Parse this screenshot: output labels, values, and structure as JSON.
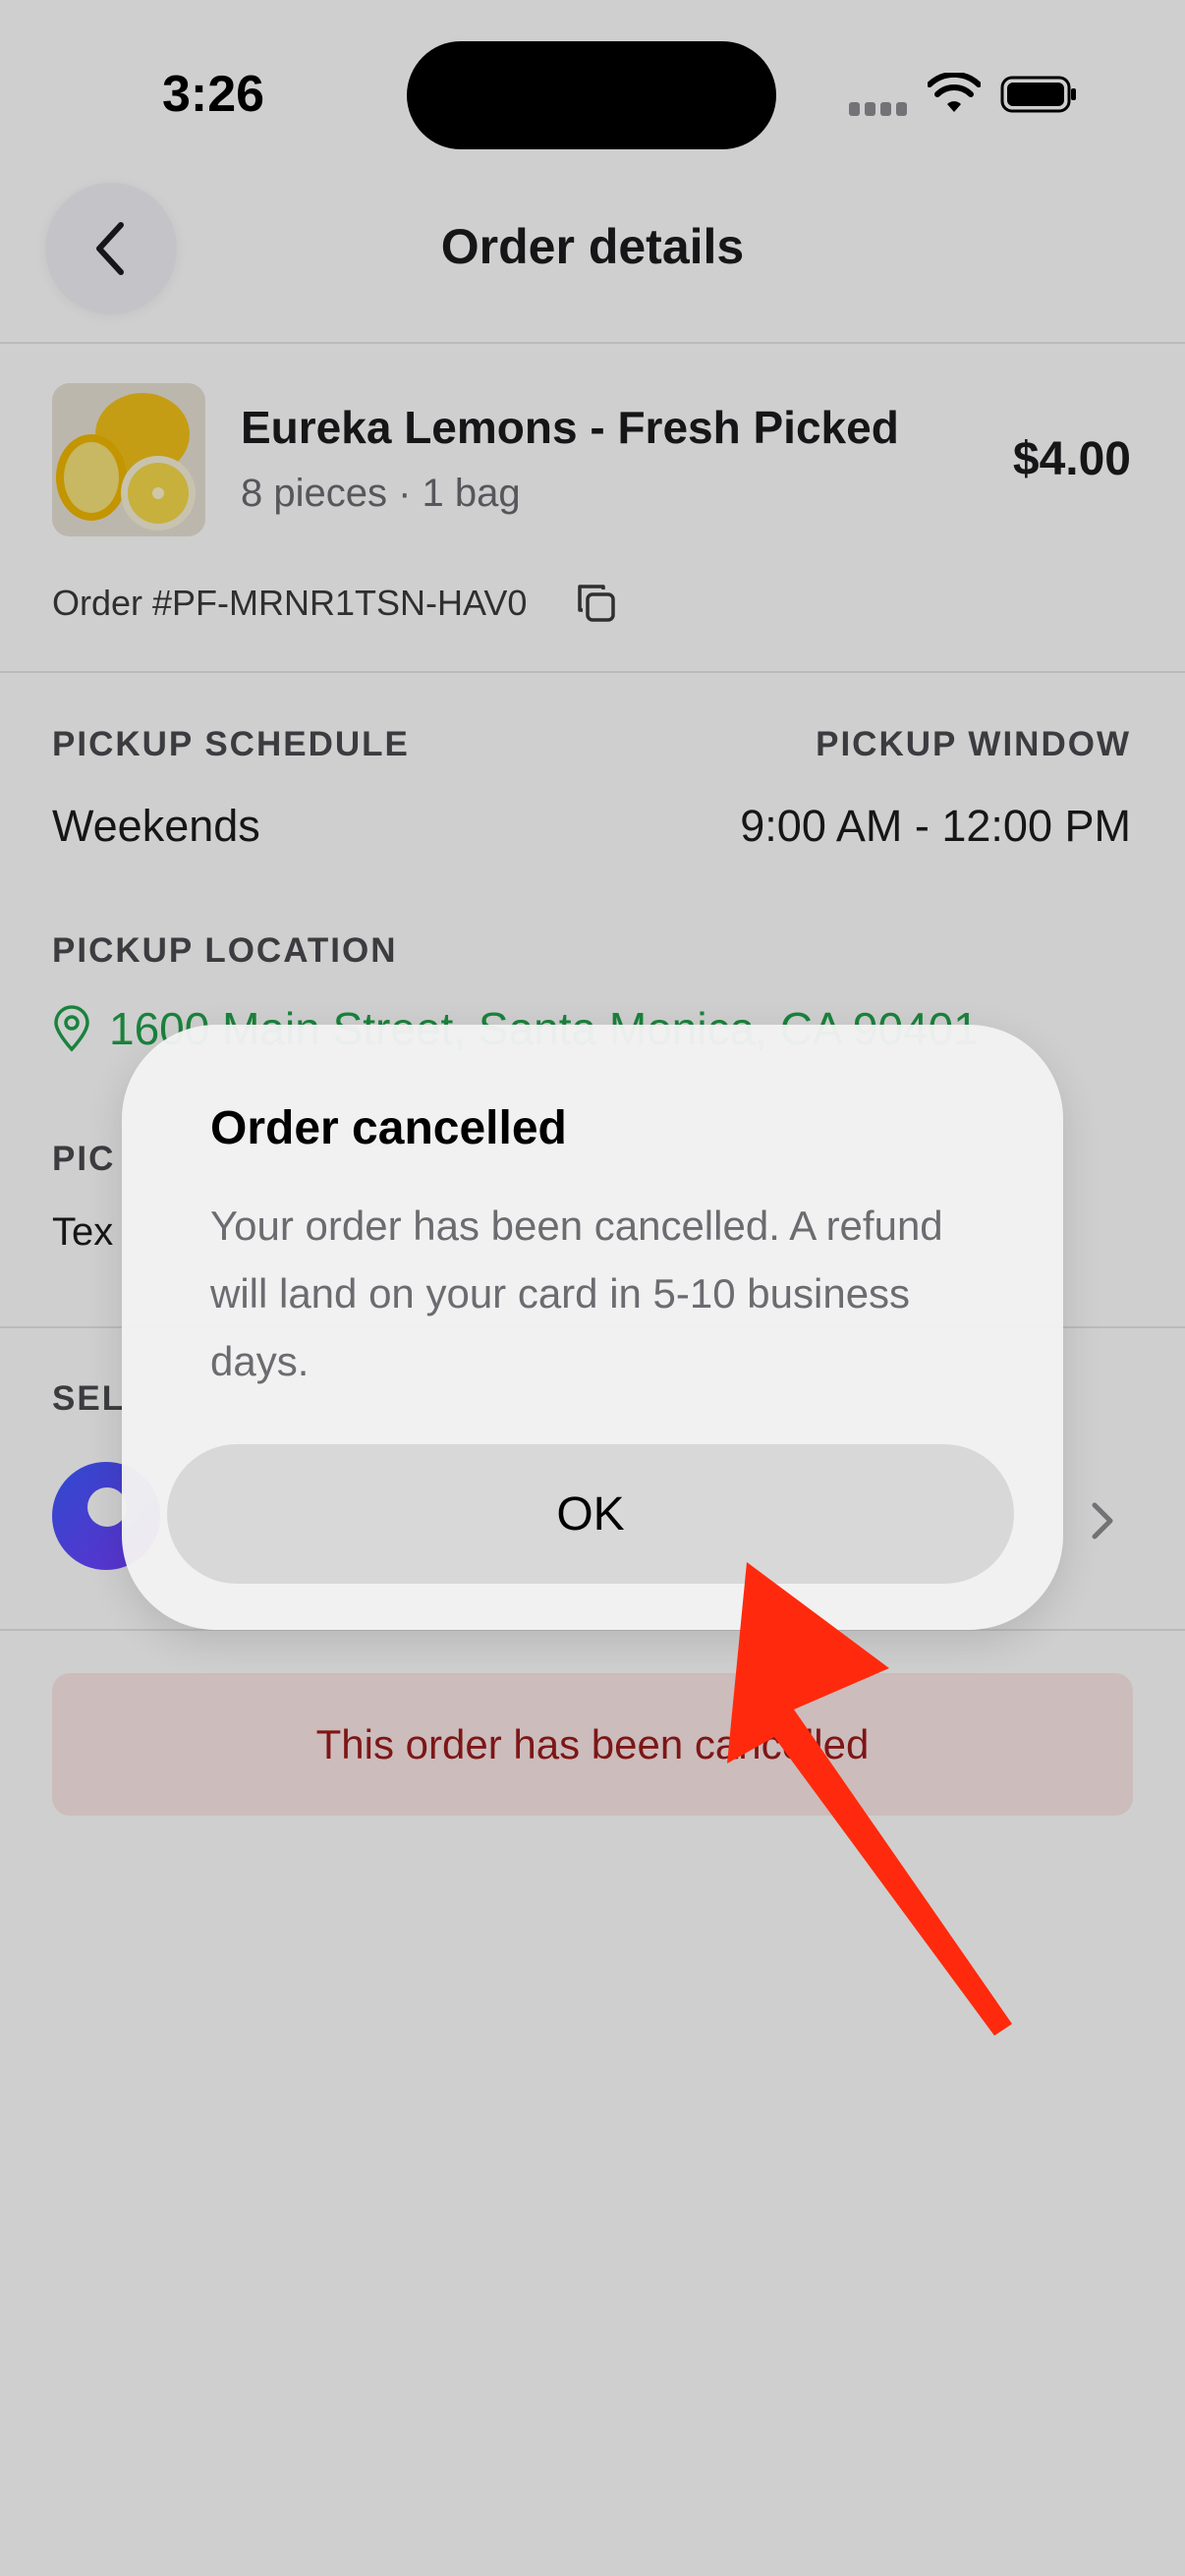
{
  "status_bar": {
    "time": "3:26"
  },
  "header": {
    "title": "Order details"
  },
  "product": {
    "name": "Eureka Lemons - Fresh Picked",
    "quantity": "8 pieces · 1 bag",
    "price": "$4.00",
    "order_number": "Order #PF-MRNR1TSN-HAV0"
  },
  "pickup": {
    "schedule_label": "PICKUP SCHEDULE",
    "schedule_value": "Weekends",
    "window_label": "PICKUP WINDOW",
    "window_value": "9:00 AM - 12:00 PM",
    "location_label": "PICKUP LOCATION",
    "location_value": "1600 Main Street, Santa Monica, CA 90401",
    "instructions_label_partial": "PIC",
    "instructions_value_partial": "Tex"
  },
  "seller": {
    "label_partial": "SEL"
  },
  "banner": {
    "text": "This order has been cancelled"
  },
  "dialog": {
    "title": "Order cancelled",
    "body": "Your order has been cancelled. A refund will land on your card in 5-10 business days.",
    "ok_label": "OK"
  },
  "colors": {
    "location_green": "#21a04a",
    "banner_bg": "#fde8e8",
    "banner_text": "#9b1c1c",
    "annotation_arrow": "#ff2a0d"
  },
  "icons": [
    "back-chevron-icon",
    "copy-icon",
    "location-pin-icon",
    "chevron-right-icon",
    "wifi-icon",
    "battery-icon",
    "signal-icon"
  ]
}
